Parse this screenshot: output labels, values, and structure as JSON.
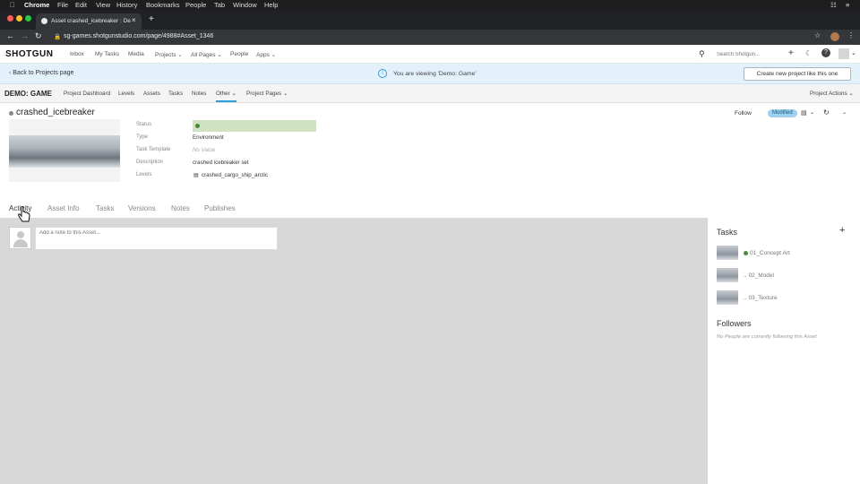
{
  "macos": {
    "app": "Chrome",
    "menus": [
      "File",
      "Edit",
      "View",
      "History",
      "Bookmarks",
      "People",
      "Tab",
      "Window",
      "Help"
    ]
  },
  "browser": {
    "tab_title": "Asset crashed_icebreaker : De",
    "url": "sg-games.shotgunstudio.com/page/4988#Asset_1346"
  },
  "app_header": {
    "logo": "SHOTGUN",
    "nav": [
      "Inbox",
      "My Tasks",
      "Media",
      "Projects",
      "All Pages",
      "People",
      "Apps"
    ],
    "search_placeholder": "Search Shotgun..."
  },
  "banner": {
    "back_link": "Back to Projects page",
    "message": "You are viewing 'Demo: Game'",
    "create_button": "Create new project like this one"
  },
  "project_nav": {
    "project_name": "DEMO: GAME",
    "items": [
      "Project Dashboard",
      "Levels",
      "Assets",
      "Tasks",
      "Notes",
      "Other",
      "Project Pages"
    ],
    "actions": "Project Actions"
  },
  "asset": {
    "name": "crashed_icebreaker",
    "follow": "Follow",
    "badge": "Modified",
    "fields": [
      {
        "label": "Status",
        "value": ""
      },
      {
        "label": "Type",
        "value": "Environment"
      },
      {
        "label": "Task Template",
        "value": "No Value"
      },
      {
        "label": "Description",
        "value": "crashed icebreaker set"
      },
      {
        "label": "Levels",
        "value": "crashed_cargo_ship_arctic"
      }
    ]
  },
  "detail_tabs": [
    "Activity",
    "Asset Info",
    "Tasks",
    "Versions",
    "Notes",
    "Publishes"
  ],
  "note_placeholder": "Add a note to this Asset...",
  "sidebar": {
    "tasks_title": "Tasks",
    "tasks": [
      "01_Concept Art",
      "02_Model",
      "03_Texture"
    ],
    "task_prefix": [
      "",
      "..",
      ".."
    ],
    "followers_title": "Followers",
    "followers_empty": "No People are currently following this Asset"
  },
  "colors": {
    "accent": "#2d9fd8",
    "status_green": "#cfe3c3",
    "banner_bg": "#e3f1fb"
  }
}
